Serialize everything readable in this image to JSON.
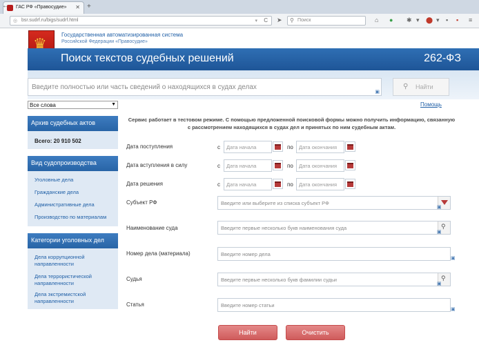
{
  "browser": {
    "tab_title": "ГАС РФ «Правосудие»",
    "url": "bsr.sudrf.ru/bigs/sudrf.html",
    "search_placeholder": "Поиск",
    "back": "←",
    "reload": "C",
    "stop": "✕",
    "new_tab": "+"
  },
  "header": {
    "system_name": "Государственная автоматизированная система",
    "system_sub": "Российской Федерации «Правосудие»",
    "title": "Поиск текстов судебных решений",
    "law": "262-ФЗ"
  },
  "search": {
    "placeholder": "Введите полностью или часть сведений о находящихся в судах делах",
    "button": "Найти",
    "scope_value": "Все слова",
    "help": "Помощь"
  },
  "notice": "Сервис работает в тестовом режиме. С помощью предложенной поисковой формы можно получить информацию, связанную с рассмотрением находящихся в судах дел и принятых по ним судебным актам.",
  "sidebar": {
    "archive": {
      "title": "Архив судебных актов",
      "total": "Всего: 20 910 502"
    },
    "proceedings": {
      "title": "Вид судопроизводства",
      "items": [
        "Уголовные дела",
        "Гражданские дела",
        "Административные дела",
        "Производство по материалам"
      ]
    },
    "criminal": {
      "title": "Категории уголовных дел",
      "items": [
        [
          "Дела коррупционной",
          "направленности"
        ],
        [
          "Дела террористической",
          "направленности"
        ],
        [
          "Дела экстремистской",
          "направленности"
        ]
      ]
    }
  },
  "form": {
    "from_word": "с",
    "to_word": "по",
    "date_start_ph": "Дата начала",
    "date_end_ph": "Дата окончания",
    "dates": [
      "Дата поступления",
      "Дата вступления в силу",
      "Дата решения"
    ],
    "subject": {
      "label": "Субъект РФ",
      "placeholder": "Введите или выберите из списка субъект РФ"
    },
    "court": {
      "label": "Наименование суда",
      "placeholder": "Введите первые несколько букв наименования суда"
    },
    "case": {
      "label": "Номер дела (материала)",
      "placeholder": "Введите номер дела"
    },
    "judge": {
      "label": "Судья",
      "placeholder": "Введите первые несколько букв фамилии судьи"
    },
    "article": {
      "label": "Статья",
      "placeholder": "Введите номер статьи"
    },
    "find": "Найти",
    "clear": "Очистить"
  }
}
